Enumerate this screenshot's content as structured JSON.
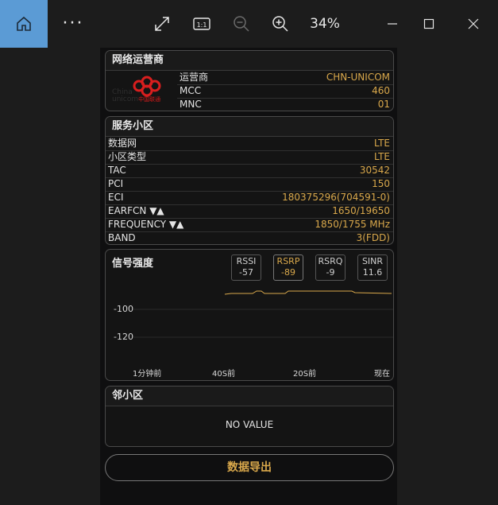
{
  "window": {
    "zoom": "34%"
  },
  "operator": {
    "title": "网络运营商",
    "logo_text": "China unicom中国联通",
    "rows": [
      {
        "k": "运营商",
        "v": "CHN-UNICOM"
      },
      {
        "k": "MCC",
        "v": "460"
      },
      {
        "k": "MNC",
        "v": "01"
      }
    ]
  },
  "cell": {
    "title": "服务小区",
    "rows": [
      {
        "k": "数据网",
        "v": "LTE"
      },
      {
        "k": "小区类型",
        "v": "LTE"
      },
      {
        "k": "TAC",
        "v": "30542"
      },
      {
        "k": "PCI",
        "v": "150"
      },
      {
        "k": "ECI",
        "v": "180375296(704591-0)"
      },
      {
        "k": "EARFCN ▼▲",
        "v": "1650/19650"
      },
      {
        "k": "FREQUENCY ▼▲",
        "v": "1850/1755 MHz"
      },
      {
        "k": "BAND",
        "v": "3(FDD)"
      }
    ]
  },
  "signal": {
    "title": "信号强度",
    "metrics": [
      {
        "name": "RSSI",
        "value": "-57",
        "active": false
      },
      {
        "name": "RSRP",
        "value": "-89",
        "active": true
      },
      {
        "name": "RSRQ",
        "value": "-9",
        "active": false
      },
      {
        "name": "SINR",
        "value": "11.6",
        "active": false
      }
    ],
    "y_labels": [
      "-100",
      "-120"
    ],
    "x_labels": [
      "1分钟前",
      "40S前",
      "20S前",
      "现在"
    ]
  },
  "neighbor": {
    "title": "邻小区",
    "empty": "NO VALUE"
  },
  "export_label": "数据导出",
  "colors": {
    "accent": "#d9a84b",
    "titlebar_active": "#5b9bd5"
  }
}
